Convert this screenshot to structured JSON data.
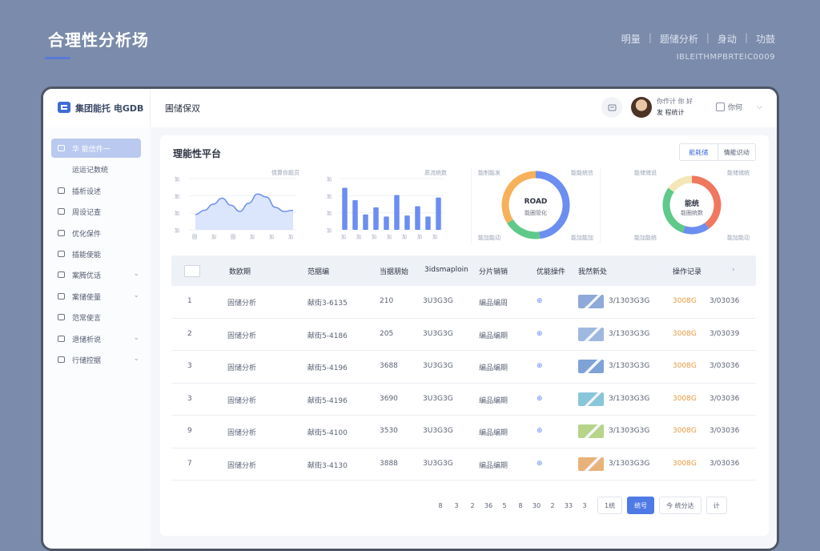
{
  "hero": {
    "title": "合理性分析场",
    "nav": [
      "明量",
      "题储分析",
      "身动",
      "功鼓"
    ],
    "subtitle": "IBLEITHMPBRTEIC0009"
  },
  "topbar": {
    "brand": "集团能托 电GDB",
    "breadcrumb": "圃储保双",
    "user_name": "你作计 你 好",
    "user_role": "发 程统计",
    "lang": "你何"
  },
  "sidebar": {
    "items": [
      {
        "label": "华 能信件一",
        "icon": "home-icon",
        "active": true,
        "chevron": false
      },
      {
        "label": "运运记数统",
        "icon": "",
        "active": false,
        "chevron": false
      },
      {
        "label": "插析设述",
        "icon": "chart-icon",
        "active": false,
        "chevron": false
      },
      {
        "label": "周设记查",
        "icon": "list-icon",
        "active": false,
        "chevron": false
      },
      {
        "label": "优化保件",
        "icon": "doc-icon",
        "active": false,
        "chevron": false
      },
      {
        "label": "插能使能",
        "icon": "folder-icon",
        "active": false,
        "chevron": false
      },
      {
        "label": "案腾优话",
        "icon": "calendar-icon",
        "active": false,
        "chevron": true
      },
      {
        "label": "案储使量",
        "icon": "grid-icon",
        "active": false,
        "chevron": true
      },
      {
        "label": "范常使言",
        "icon": "user-icon",
        "active": false,
        "chevron": false
      },
      {
        "label": "退储析说",
        "icon": "monitor-icon",
        "active": false,
        "chevron": true
      },
      {
        "label": "行储控据",
        "icon": "settings-icon",
        "active": false,
        "chevron": true
      }
    ]
  },
  "panel": {
    "title": "理能性平台",
    "segment": [
      "能耗储",
      "情能识动"
    ]
  },
  "charts": {
    "card1": {
      "tag": "情算你题员",
      "y_ticks": [
        "加",
        "加",
        "加",
        "加"
      ],
      "x_ticks": [
        "圆",
        "加",
        "圆",
        "加",
        "加",
        "加"
      ]
    },
    "card2": {
      "tag": "质流统数",
      "y_ticks": [
        "加",
        "加",
        "加",
        "加"
      ],
      "x_ticks": [
        "加",
        "加",
        "加",
        "加",
        "加",
        "加",
        "加"
      ]
    },
    "donut1": {
      "tl": "能制能发",
      "tr": "能能统信",
      "bl": "能加能动",
      "br": "能加能加",
      "center_top": "ROAD",
      "center_bot": "能圈管化"
    },
    "donut2": {
      "tl": "能储储说",
      "tr": "能储储统",
      "bl": "能加能统",
      "br": "能加能动",
      "center_top": "能统",
      "center_bot": "能圈统数"
    }
  },
  "chart_data": [
    {
      "type": "area",
      "x": [
        1,
        2,
        3,
        4,
        5,
        6,
        7,
        8,
        9,
        10,
        11,
        12
      ],
      "values": [
        30,
        38,
        50,
        62,
        48,
        36,
        52,
        70,
        64,
        44,
        36,
        38
      ],
      "ylim": [
        0,
        100
      ]
    },
    {
      "type": "bar",
      "values": [
        82,
        58,
        30,
        44,
        26,
        68,
        28,
        46,
        26,
        63
      ],
      "ylim": [
        0,
        100
      ]
    },
    {
      "type": "pie",
      "colors": [
        "#6b8ef0",
        "#5fc98a",
        "#f6b15a"
      ],
      "values": [
        48,
        18,
        34
      ]
    },
    {
      "type": "pie",
      "colors": [
        "#f0785f",
        "#6b8ef0",
        "#5fc98a",
        "#f3e7b8"
      ],
      "values": [
        40,
        15,
        30,
        15
      ]
    }
  ],
  "table": {
    "headers": [
      "数欧期",
      "范据编",
      "当据朋始",
      "3idsmaploin",
      "分片销销",
      "优能操件",
      "我然新处",
      "操作记录"
    ],
    "rows": [
      {
        "no": "1",
        "name": "固储分析",
        "code": "献街3-6135",
        "num": "210",
        "date": "3U3G3G",
        "cat": "编品编周",
        "thumb": "#8fa9d8",
        "stat": "3/1303G3G",
        "price": "3008G",
        "tail": "3/03036"
      },
      {
        "no": "2",
        "name": "固储分析",
        "code": "献街5-4186",
        "num": "205",
        "date": "3U3G3G",
        "cat": "编品编期",
        "thumb": "#9fb8e0",
        "stat": "3/1303G3G",
        "price": "3008G",
        "tail": "3/03039"
      },
      {
        "no": "3",
        "name": "固储分析",
        "code": "献街5-4196",
        "num": "3688",
        "date": "3U3G3G",
        "cat": "编品编期",
        "thumb": "#7fa3d6",
        "stat": "3/1303G3G",
        "price": "3008G",
        "tail": "3/03036"
      },
      {
        "no": "3",
        "name": "固储分析",
        "code": "献街5-4196",
        "num": "3690",
        "date": "3U3G3G",
        "cat": "编品编期",
        "thumb": "#8ac6d9",
        "stat": "3/1303G3G",
        "price": "3008G",
        "tail": "3/03036"
      },
      {
        "no": "9",
        "name": "固储分析",
        "code": "献街5-4100",
        "num": "3530",
        "date": "3U3G3G",
        "cat": "编品编期",
        "thumb": "#b7d48a",
        "stat": "3/1303G3G",
        "price": "3008G",
        "tail": "3/03036"
      },
      {
        "no": "7",
        "name": "固储分析",
        "code": "献街3-4130",
        "num": "3888",
        "date": "3U3G3G",
        "cat": "编品编期",
        "thumb": "#e9b27a",
        "stat": "3/1303G3G",
        "price": "3008G",
        "tail": "3/03036"
      }
    ]
  },
  "pager": {
    "pages": [
      "8",
      "3",
      "2",
      "36",
      "5",
      "8",
      "30",
      "2",
      "33",
      "3"
    ],
    "prev": "1统",
    "current": "统号",
    "size": "今 统分达",
    "jump": "计"
  }
}
